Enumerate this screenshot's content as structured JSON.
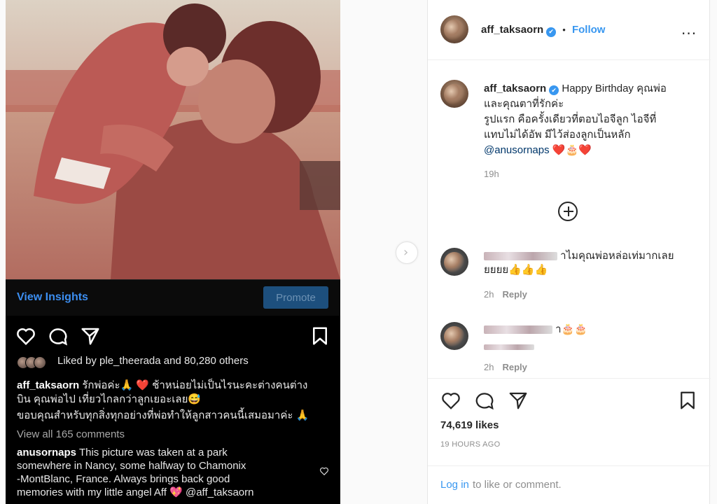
{
  "phone": {
    "view_insights": "View Insights",
    "promote": "Promote",
    "liked_by": "Liked by ple_theerada and 80,280 others",
    "caption_user": "aff_taksaorn",
    "caption_line1": "รักพ่อค่ะ🙏 ❤️ ช้าหน่อยไม่เป็นไรนะคะต่างคนต่าง",
    "caption_line2": "บิน คุณพ่อไป เที่ยวไกลกว่าลูกเยอะเลย😅",
    "caption_line3": "ขอบคุณสำหรับทุกสิ่งทุกอย่างที่พ่อทำให้ลูกสาวคนนี้เสมอมาค่ะ 🙏",
    "view_all": "View all 165 comments",
    "comment_user": "anusornaps",
    "comment_line1": "This picture was taken at a park",
    "comment_line2": "somewhere in Nancy, some halfway to Chamonix",
    "comment_line3": "-MontBlanc, France.  Always brings back good",
    "comment_line4": "memories with my little angel Aff 💖 @aff_taksaorn"
  },
  "header": {
    "username": "aff_taksaorn",
    "verified_mark": "✔",
    "separator": "•",
    "follow": "Follow",
    "more": "..."
  },
  "caption": {
    "username": "aff_taksaorn",
    "text1": "Happy Birthday คุณพ่อ",
    "text2": "และคุณตาที่รักค่ะ",
    "text3": "รูปแรก คือครั้งเดียวที่ตอบไอจีลูก ไอจีที่",
    "text4": "แทบไม่ได้อัพ มีไว้ส่องลูกเป็นหลัก",
    "mention": "@anusornaps",
    "emojis": "❤️🎂❤️",
    "time": "19h"
  },
  "comments": [
    {
      "text1": "าไมคุณพ่อหล่อเท่มากเลย",
      "text2": "ยยยย👍👍👍",
      "time": "2h",
      "reply": "Reply"
    },
    {
      "text1": "า🎂🎂",
      "time": "2h",
      "reply": "Reply"
    }
  ],
  "actions": {
    "likes": "74,619 likes",
    "time": "19 HOURS AGO"
  },
  "login": {
    "link": "Log in",
    "rest": "to like or comment."
  },
  "icons": {
    "heart": "heart-icon",
    "comment": "comment-icon",
    "share": "share-icon",
    "save": "bookmark-icon",
    "add": "plus-circle-icon",
    "next": "chevron-right-icon"
  },
  "colors": {
    "link_blue": "#3897f0",
    "text": "#262626",
    "muted": "#8e8e8e"
  }
}
